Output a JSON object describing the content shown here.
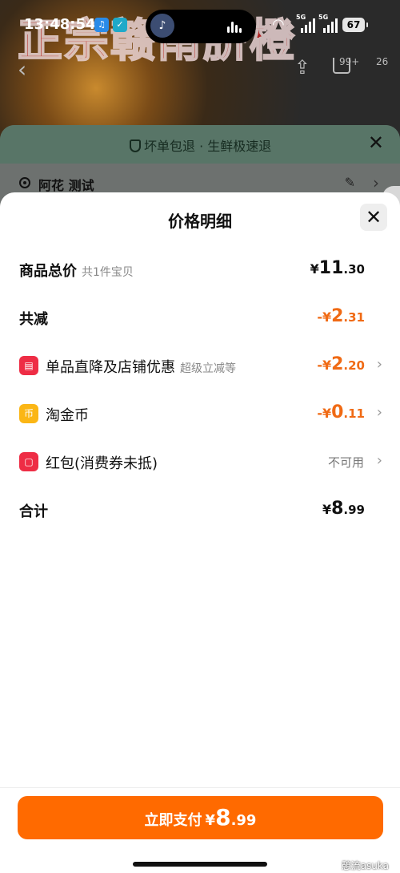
{
  "status_bar": {
    "time": "13:48:54",
    "signal_label_1": "5G",
    "signal_label_2": "5G",
    "battery": "67"
  },
  "background_page": {
    "banner_text": "正宗赣南脐橙",
    "cart_badge_1": "99+",
    "cart_badge_2": "26"
  },
  "order_sheet": {
    "slogan": "坏单包退 · 生鲜极速退",
    "address": "阿花 测试"
  },
  "price_sheet": {
    "title": "价格明细",
    "rows": [
      {
        "label": "商品总价",
        "sub": "共1件宝贝",
        "currency": "¥",
        "int": "11",
        "dec": ".30"
      },
      {
        "label": "共减",
        "currency": "-¥",
        "int": "2",
        "dec": ".31"
      },
      {
        "label": "单品直降及店铺优惠",
        "sub": "超级立减等",
        "currency": "-¥",
        "int": "2",
        "dec": ".20",
        "icon": "shop-coupon-icon",
        "icon_color": "#ee2d45"
      },
      {
        "label": "淘金币",
        "currency": "-¥",
        "int": "0",
        "dec": ".11",
        "icon": "coin-icon",
        "icon_color": "#fbb615"
      },
      {
        "label": "红包(消费券未抵)",
        "status": "不可用",
        "icon": "red-packet-icon",
        "icon_color": "#ee2d45"
      },
      {
        "label": "合计",
        "currency": "¥",
        "int": "8",
        "dec": ".99"
      }
    ]
  },
  "bottom": {
    "pay_label": "立即支付",
    "pay_currency": "¥",
    "pay_int": "8",
    "pay_dec": ".99",
    "watermark": "憩流asuka"
  },
  "colors": {
    "accent_orange": "#ff6a00",
    "discount_orange": "#f06a14"
  }
}
